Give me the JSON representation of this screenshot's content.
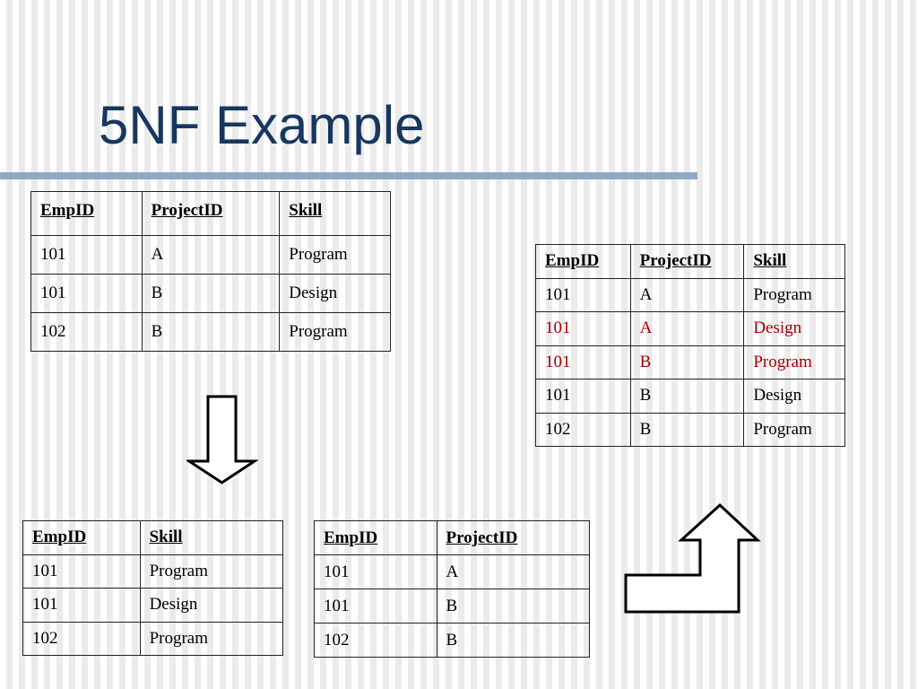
{
  "title": "5NF Example",
  "tables": {
    "emp_proj_skill": {
      "headers": [
        "EmpID",
        "ProjectID",
        "Skill"
      ],
      "rows": [
        [
          "101",
          "A",
          "Program"
        ],
        [
          "101",
          "B",
          "Design"
        ],
        [
          "102",
          "B",
          "Program"
        ]
      ]
    },
    "joined": {
      "headers": [
        "EmpID",
        "ProjectID",
        "Skill"
      ],
      "rows": [
        [
          "101",
          "A",
          "Program"
        ],
        [
          "101",
          "A",
          "Design"
        ],
        [
          "101",
          "B",
          "Program"
        ],
        [
          "101",
          "B",
          "Design"
        ],
        [
          "102",
          "B",
          "Program"
        ]
      ],
      "highlight_color": "#a00000"
    },
    "emp_skill": {
      "headers": [
        "EmpID",
        "Skill"
      ],
      "rows": [
        [
          "101",
          "Program"
        ],
        [
          "101",
          "Design"
        ],
        [
          "102",
          "Program"
        ]
      ]
    },
    "emp_proj": {
      "headers": [
        "EmpID",
        "ProjectID"
      ],
      "rows": [
        [
          "101",
          "A"
        ],
        [
          "101",
          "B"
        ],
        [
          "102",
          "B"
        ]
      ]
    }
  },
  "arrows": [
    "down-arrow-icon",
    "bent-up-arrow-icon"
  ],
  "colors": {
    "title": "#17375e",
    "rule": "#8faac7"
  }
}
